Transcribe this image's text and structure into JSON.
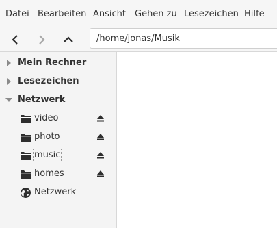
{
  "menubar": {
    "items": [
      {
        "label": "Datei"
      },
      {
        "label": "Bearbeiten"
      },
      {
        "label": "Ansicht"
      },
      {
        "label": "Gehen zu"
      },
      {
        "label": "Lesezeichen"
      },
      {
        "label": "Hilfe"
      }
    ]
  },
  "toolbar": {
    "back_icon": "chevron-left-icon",
    "forward_icon": "chevron-right-icon",
    "up_icon": "chevron-up-icon",
    "location": "/home/jonas/Musik"
  },
  "sidebar": {
    "sections": [
      {
        "label": "Mein Rechner",
        "expanded": false
      },
      {
        "label": "Lesezeichen",
        "expanded": false
      },
      {
        "label": "Netzwerk",
        "expanded": true
      }
    ],
    "network_items": [
      {
        "label": "video",
        "icon": "folder-icon",
        "eject": true
      },
      {
        "label": "photo",
        "icon": "folder-icon",
        "eject": true
      },
      {
        "label": "music",
        "icon": "folder-icon",
        "eject": true,
        "focused": true
      },
      {
        "label": "homes",
        "icon": "folder-icon",
        "eject": true
      },
      {
        "label": "Netzwerk",
        "icon": "globe-icon",
        "eject": false
      }
    ]
  },
  "colors": {
    "window_bg": "#f6f6f6",
    "content_bg": "#ffffff",
    "icon": "#2e2e2e",
    "expander": "#8a8a8a"
  }
}
